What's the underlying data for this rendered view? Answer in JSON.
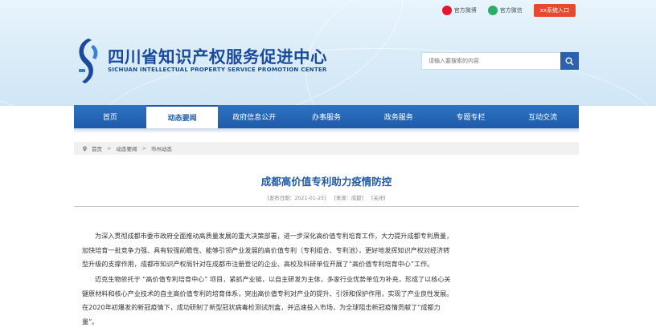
{
  "topbar": {
    "weibo_label": "官方微博",
    "wechat_label": "官方微信",
    "login_label": "xx系统入口",
    "weibo_icon": "weibo-icon",
    "wechat_icon": "wechat-icon"
  },
  "header": {
    "title_cn": "四川省知识产权服务促进中心",
    "title_en": "SICHUAN INTELLECTUAL PROPERTY SERVICE PROMOTION CENTER",
    "search_placeholder": "请输入要搜索的内容"
  },
  "nav": {
    "items": [
      {
        "label": "首页"
      },
      {
        "label": "动态要闻"
      },
      {
        "label": "政府信息公开"
      },
      {
        "label": "办事服务"
      },
      {
        "label": "政务服务"
      },
      {
        "label": "专题专栏"
      },
      {
        "label": "互动交流"
      }
    ],
    "active_index": 1
  },
  "breadcrumb": {
    "home": "首页",
    "level1": "动态要闻",
    "level2": "市州动态"
  },
  "article": {
    "title": "成都高价值专利助力疫情防控",
    "date": "[发布日期：2021-01-25]",
    "source": "[来源：成都]",
    "close": "[关闭]",
    "p1_lines": [
      "为深入贯彻成都市委市政府全面推动高质量发展的重大决策部署，进一步深化高价值专利培育工作，大力提升成都专利质量，",
      "加快培育一批竞争力强、具有较强前瞻性、能够引领产业发展的高价值专利（专利组合、专利池），更好地发挥知识产权对经济转",
      "型升级的支撑作用，成都市知识产权局针对在成都市注册登记的企业、高校及科研单位开展了“高价值专利培育中心”工作。"
    ],
    "p2_lines": [
      "迈克生物依托于 “高价值专利培育中心” 项目，紧抓产业链，以自主研发为主体，多家行业优势单位为补充，形成了以核心关",
      "键原材料和核心产业技术的自主高价值专利的培育体系，突出高价值专利对产业的提升、引领和保护作用，实现了产业良性发展。",
      "在2020年初爆发的新冠疫情下，成功研制了新型冠状病毒检测试剂盒，并迅速投入市场，为全球阻击新冠疫情贡献了“成都力",
      "量”。"
    ]
  },
  "colors": {
    "primary": "#1f5aa8",
    "header_bg": "#dcedf9",
    "login_bg": "#e64a2e"
  }
}
